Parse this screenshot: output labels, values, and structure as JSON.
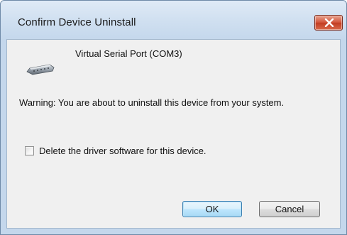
{
  "window": {
    "title": "Confirm Device Uninstall",
    "close_icon": "close-icon"
  },
  "dialog": {
    "device_icon": "serial-port-icon",
    "device_name": "Virtual Serial Port (COM3)",
    "warning": "Warning: You are about to uninstall this device from your system.",
    "checkbox": {
      "label": "Delete the driver software for this device.",
      "checked": false
    },
    "buttons": {
      "ok_label": "OK",
      "cancel_label": "Cancel"
    }
  },
  "colors": {
    "close_button": "#c94a2e",
    "ok_button_border": "#3c7fb1",
    "client_background": "#f0f0f0",
    "frame": "#cfdff0"
  }
}
